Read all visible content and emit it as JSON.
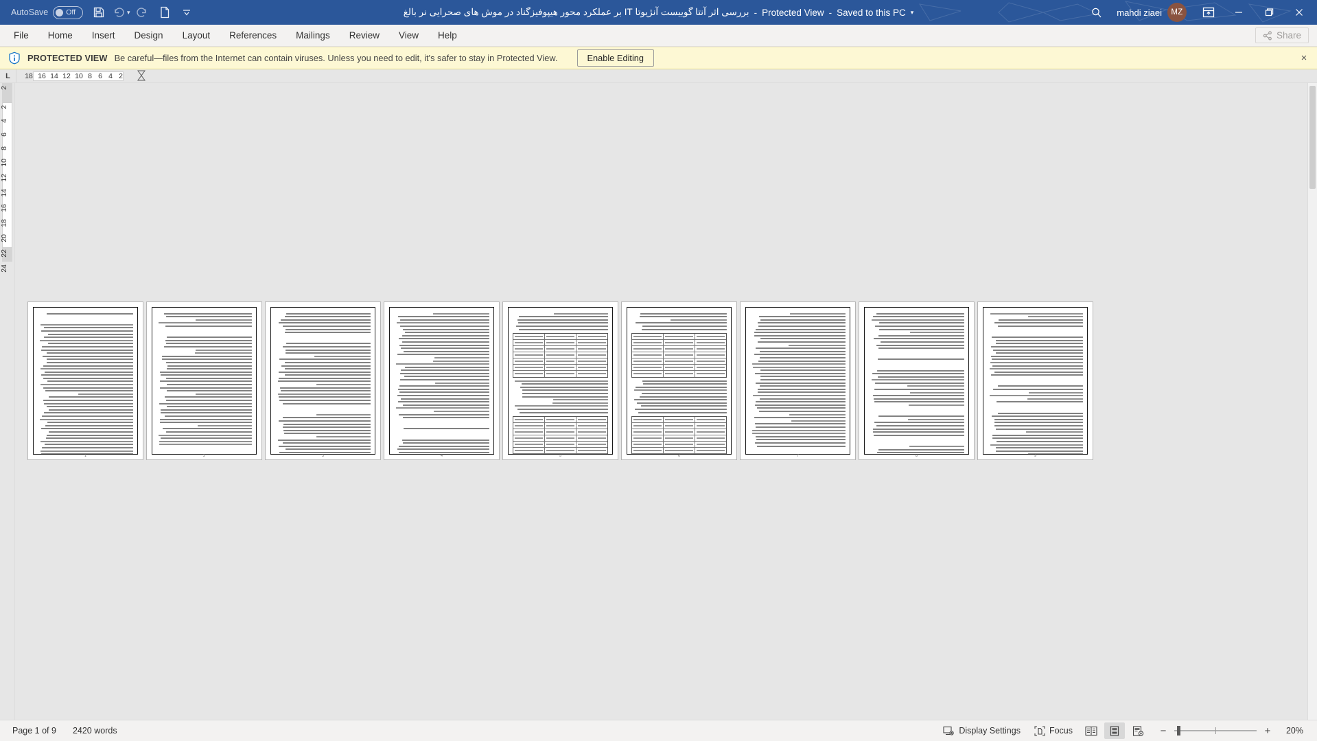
{
  "titlebar": {
    "autosave_label": "AutoSave",
    "autosave_state": "Off",
    "quick_access": [
      {
        "name": "save-icon",
        "label": "Save"
      },
      {
        "name": "undo-icon",
        "label": "Undo"
      },
      {
        "name": "redo-icon",
        "label": "Redo"
      },
      {
        "name": "new-document-icon",
        "label": "New"
      },
      {
        "name": "customize-quick-access-toolbar-icon",
        "label": "Customize Quick Access Toolbar"
      }
    ],
    "document_name": "بررسی اثر آنتا گوییست آنژیوتا IT بر عملکرد محور هیپوفیزگناد در موش های صحرایی نر بالغ",
    "protected_view_label": "Protected View",
    "save_location": "Saved to this PC",
    "separator": "-",
    "search_label": "Search",
    "user_name": "mahdi ziaei",
    "user_initials": "MZ",
    "ribbon_display_options": "Ribbon Display Options",
    "minimize": "Minimize",
    "restore": "Restore Down",
    "close": "Close",
    "accent_color": "#2b579a",
    "avatar_color": "#8a5340"
  },
  "ribbon": {
    "tabs": [
      {
        "label": "File"
      },
      {
        "label": "Home"
      },
      {
        "label": "Insert"
      },
      {
        "label": "Design"
      },
      {
        "label": "Layout"
      },
      {
        "label": "References"
      },
      {
        "label": "Mailings"
      },
      {
        "label": "Review"
      },
      {
        "label": "View"
      },
      {
        "label": "Help"
      }
    ],
    "share_label": "Share"
  },
  "protected_view": {
    "badge": "PROTECTED VIEW",
    "message": "Be careful—files from the Internet can contain viruses. Unless you need to edit, it's safer to stay in Protected View.",
    "enable_editing_label": "Enable Editing",
    "close_label": "×",
    "background_color": "#fdf8d4"
  },
  "rulers": {
    "tab_stop_marker": "L",
    "horizontal_numbers": [
      "18",
      "16",
      "14",
      "12",
      "10",
      "8",
      "6",
      "4",
      "2"
    ],
    "vertical_numbers": [
      "2",
      "2",
      "4",
      "6",
      "8",
      "10",
      "12",
      "14",
      "16",
      "18",
      "20",
      "22",
      "24"
    ]
  },
  "document": {
    "page_count": 9,
    "pages": [
      {
        "number": "1",
        "has_table": false
      },
      {
        "number": "2",
        "has_table": false
      },
      {
        "number": "3",
        "has_table": false
      },
      {
        "number": "4",
        "has_table": false
      },
      {
        "number": "5",
        "has_table": true
      },
      {
        "number": "6",
        "has_table": true
      },
      {
        "number": "7",
        "has_table": false
      },
      {
        "number": "8",
        "has_table": false
      },
      {
        "number": "9",
        "has_table": false
      }
    ]
  },
  "statusbar": {
    "page_status": "Page 1 of 9",
    "word_count": "2420 words",
    "display_settings_label": "Display Settings",
    "focus_label": "Focus",
    "view_read_mode": "Read Mode",
    "view_print_layout": "Print Layout",
    "view_web_layout": "Web Layout",
    "zoom_out_label": "−",
    "zoom_in_label": "+",
    "zoom_level": "20%"
  }
}
